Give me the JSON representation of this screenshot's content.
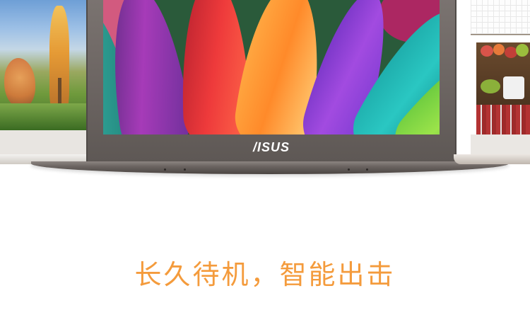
{
  "brand": {
    "logo_text": "/ISUS"
  },
  "tagline": {
    "text": "长久待机，智能出击",
    "color": "#f49b3c"
  },
  "icons": [
    "laptop-left",
    "laptop-center",
    "laptop-right"
  ]
}
